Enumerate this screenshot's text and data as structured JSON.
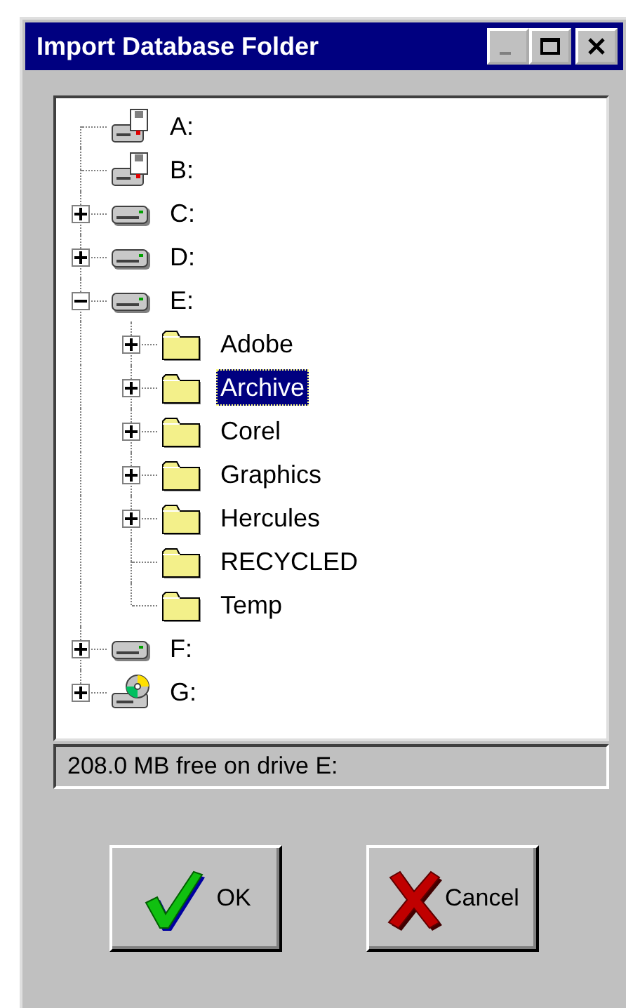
{
  "window": {
    "title": "Import Database Folder"
  },
  "tree": {
    "items": [
      {
        "label": "A:",
        "kind": "floppy",
        "selected": false
      },
      {
        "label": "B:",
        "kind": "floppy",
        "selected": false
      },
      {
        "label": "C:",
        "kind": "drive",
        "expanded": false,
        "selected": false
      },
      {
        "label": "D:",
        "kind": "drive",
        "expanded": false,
        "selected": false
      },
      {
        "label": "E:",
        "kind": "drive",
        "expanded": true,
        "selected": false,
        "children": [
          {
            "label": "Adobe",
            "kind": "folder",
            "expanded": false,
            "selected": false
          },
          {
            "label": "Archive",
            "kind": "folder",
            "expanded": false,
            "selected": true
          },
          {
            "label": "Corel",
            "kind": "folder",
            "expanded": false,
            "selected": false
          },
          {
            "label": "Graphics",
            "kind": "folder",
            "expanded": false,
            "selected": false
          },
          {
            "label": "Hercules",
            "kind": "folder",
            "expanded": false,
            "selected": false
          },
          {
            "label": "RECYCLED",
            "kind": "folder",
            "selected": false
          },
          {
            "label": "Temp",
            "kind": "folder",
            "selected": false
          }
        ]
      },
      {
        "label": "F:",
        "kind": "drive",
        "expanded": false,
        "selected": false
      },
      {
        "label": "G:",
        "kind": "cdrom",
        "expanded": false,
        "selected": false
      }
    ]
  },
  "status_bar": "208.0 MB free on drive E:",
  "buttons": [
    {
      "label": "OK",
      "kind": "ok"
    },
    {
      "label": "Cancel",
      "kind": "cancel"
    }
  ]
}
